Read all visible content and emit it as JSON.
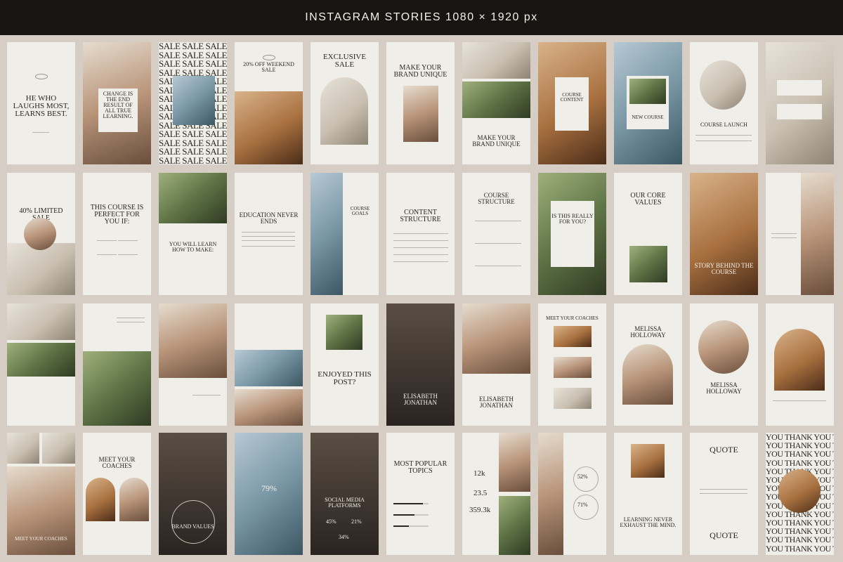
{
  "header": {
    "title": "INSTAGRAM STORIES 1080 × 1920 px"
  },
  "row1": {
    "quote1": "HE WHO LAUGHS MOST, LEARNS BEST.",
    "quote2": "CHANGE IS THE END RESULT OF ALL TRUE LEARNING.",
    "sale_word": "SALE SALE SALE SALE",
    "weekend": "20% OFF WEEKEND SALE",
    "exclusive": "EXCLUSIVE SALE",
    "brand": "MAKE YOUR BRAND UNIQUE",
    "brand2": "MAKE YOUR BRAND UNIQUE",
    "course_content": "COURSE CONTENT",
    "new_course": "NEW COURSE",
    "course_launch": "COURSE LAUNCH"
  },
  "row2": {
    "limited": "40% LIMITED SALE",
    "perfect": "THIS COURSE IS PERFECT FOR YOU IF:",
    "learn": "YOU WILL LEARN HOW TO MAKE:",
    "education": "EDUCATION NEVER ENDS",
    "goals": "COURSE GOALS",
    "content": "CONTENT STRUCTURE",
    "structure": "COURSE STRUCTURE",
    "really": "IS THIS REALLY FOR YOU?",
    "values": "OUR CORE VALUES",
    "story": "STORY BEHIND THE COURSE"
  },
  "row3": {
    "enjoyed": "ENJOYED THIS POST?",
    "elisabeth1": "ELISABETH JONATHAN",
    "elisabeth2": "ELISABETH JONATHAN",
    "coaches": "MEET YOUR COACHES",
    "melissa1": "MELISSA HOLLOWAY",
    "melissa2": "MELISSA HOLLOWAY"
  },
  "row4": {
    "coaches1": "MEET YOUR COACHES",
    "coaches2": "MEET YOUR COACHES",
    "brand_values": "BRAND VALUES",
    "pct79": "79%",
    "social": "SOCIAL MEDIA PLATFORMS",
    "pct45": "45%",
    "pct21": "21%",
    "pct34": "34%",
    "popular": "MOST POPULAR TOPICS",
    "stat1": "12k",
    "stat2": "23.5",
    "stat3": "359.3k",
    "pct52": "52%",
    "pct71": "71%",
    "learning": "LEARNING NEVER EXHAUST THE MIND.",
    "quote_top": "QUOTE",
    "quote_bottom": "QUOTE",
    "thankyou": "YOU THANK YOU THANK"
  }
}
